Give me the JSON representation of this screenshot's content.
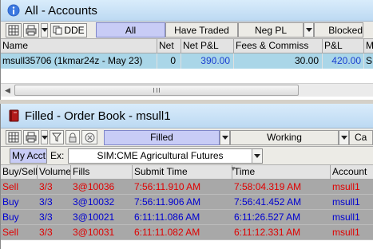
{
  "accounts": {
    "title": "All - Accounts",
    "toolbar": {
      "dde_label": "DDE"
    },
    "tabs": [
      "All",
      "Have Traded",
      "Neg PL",
      "Blocked"
    ],
    "columns": [
      "Name",
      "Net",
      "Net P&L",
      "Fees & Commiss",
      "P&L",
      "M"
    ],
    "row": {
      "name": "msull35706 (1kmar24z - May 23)",
      "net": "0",
      "net_pl": "390.00",
      "fees": "30.00",
      "pl": "420.00",
      "m": "S"
    }
  },
  "orderbook": {
    "title": "Filled - Order Book - msull1",
    "tabs": [
      "Filled",
      "Working",
      "Ca"
    ],
    "my_account_label": "My Acct",
    "ex_label": "Ex:",
    "ex_value": "SIM:CME Agricultural Futures",
    "columns": [
      "Buy/Sell",
      "Volume",
      "Fills",
      "Submit Time",
      "Time",
      "Account"
    ],
    "rows": [
      {
        "side": "Sell",
        "volume": "3/3",
        "fills": "3@10036",
        "submit": "7:56:11.910 AM",
        "time": "7:58:04.319 AM",
        "account": "msull1"
      },
      {
        "side": "Buy",
        "volume": "3/3",
        "fills": "3@10032",
        "submit": "7:56:11.906 AM",
        "time": "7:56:41.452 AM",
        "account": "msull1"
      },
      {
        "side": "Buy",
        "volume": "3/3",
        "fills": "3@10021",
        "submit": "6:11:11.086 AM",
        "time": "6:11:26.527 AM",
        "account": "msull1"
      },
      {
        "side": "Sell",
        "volume": "3/3",
        "fills": "3@10031",
        "submit": "6:11:11.082 AM",
        "time": "6:11:12.331 AM",
        "account": "msull1"
      }
    ]
  },
  "colors": {
    "buy": "#0000d0",
    "sell": "#e00000",
    "row_highlight": "#aad6e8",
    "active_tab": "#c8ccf6",
    "pl_value": "#1a3fd0"
  }
}
